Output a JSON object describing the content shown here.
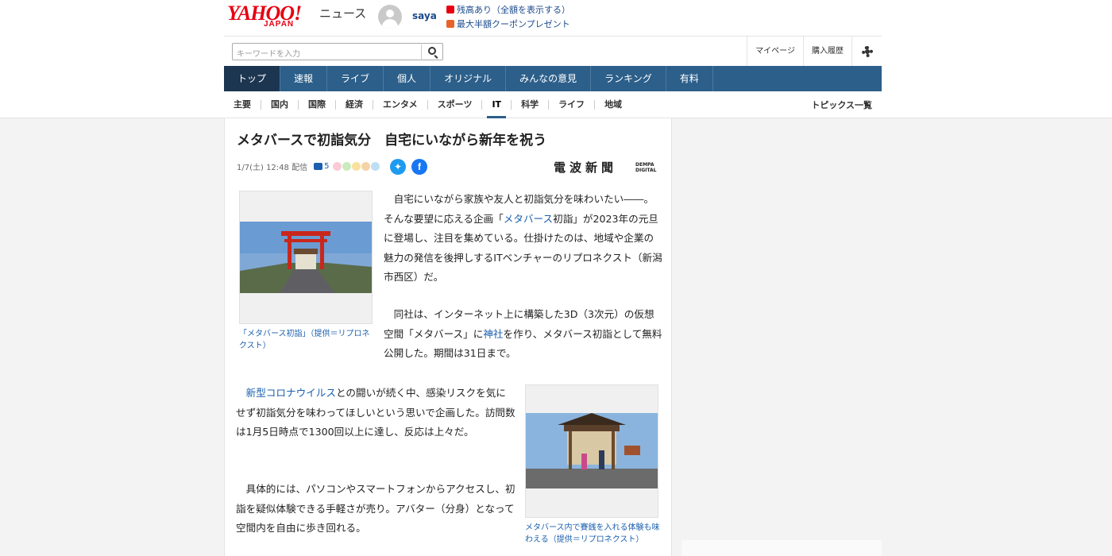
{
  "header": {
    "logo": "YAHOO!",
    "logo_sub": "JAPAN",
    "service": "ニュース",
    "username": "saya",
    "promo1": "残高あり（全額を表示する）",
    "promo2": "最大半額クーポンプレゼント"
  },
  "search": {
    "placeholder": "キーワードを入力",
    "mypage": "マイページ",
    "history": "購入履歴"
  },
  "nav": [
    "トップ",
    "速報",
    "ライブ",
    "個人",
    "オリジナル",
    "みんなの意見",
    "ランキング",
    "有料"
  ],
  "subnav": [
    "主要",
    "国内",
    "国際",
    "経済",
    "エンタメ",
    "スポーツ",
    "IT",
    "科学",
    "ライフ",
    "地域"
  ],
  "subnav_right": "トピックス一覧",
  "article": {
    "title": "メタバースで初詣気分　自宅にいながら新年を祝う",
    "date": "1/7(土) 12:48",
    "delivered": "配信",
    "comments": "5",
    "source": "電波新聞",
    "source_sub1": "DEMPA",
    "source_sub2": "DIGITAL",
    "p1a": "自宅にいながら家族や友人と初詣気分を味わいたい――。そんな要望に応える企画「",
    "p1link": "メタバース",
    "p1b": "初詣」が2023年の元旦に登場し、注目を集めている。仕掛けたのは、地域や企業の魅力の発信を後押しするITベンチャーのリプロネクスト（新潟市西区）だ。",
    "p2a": "同社は、インターネット上に構築した3D（3次元）の仮想空間「メタバース」に",
    "p2link": "神社",
    "p2b": "を作り、メタバース初詣として無料公開した。期間は31日まで。",
    "p3link": "新型コロナウイルス",
    "p3b": "との闘いが続く中、感染リスクを気にせず初詣気分を味わってほしいという思いで企画した。訪問数は1月5日時点で1300回以上に達し、反応は上々だ。",
    "p4": "具体的には、パソコンやスマートフォンからアクセスし、初詣を疑似体験できる手軽さが売り。アバター（分身）となって空間内を自由に歩き回れる。",
    "caption1": "「メタバース初詣」（提供＝リプロネクスト）",
    "caption2": "メタバース内で賽銭を入れる体験も味わえる（提供＝リプロネクスト）"
  }
}
